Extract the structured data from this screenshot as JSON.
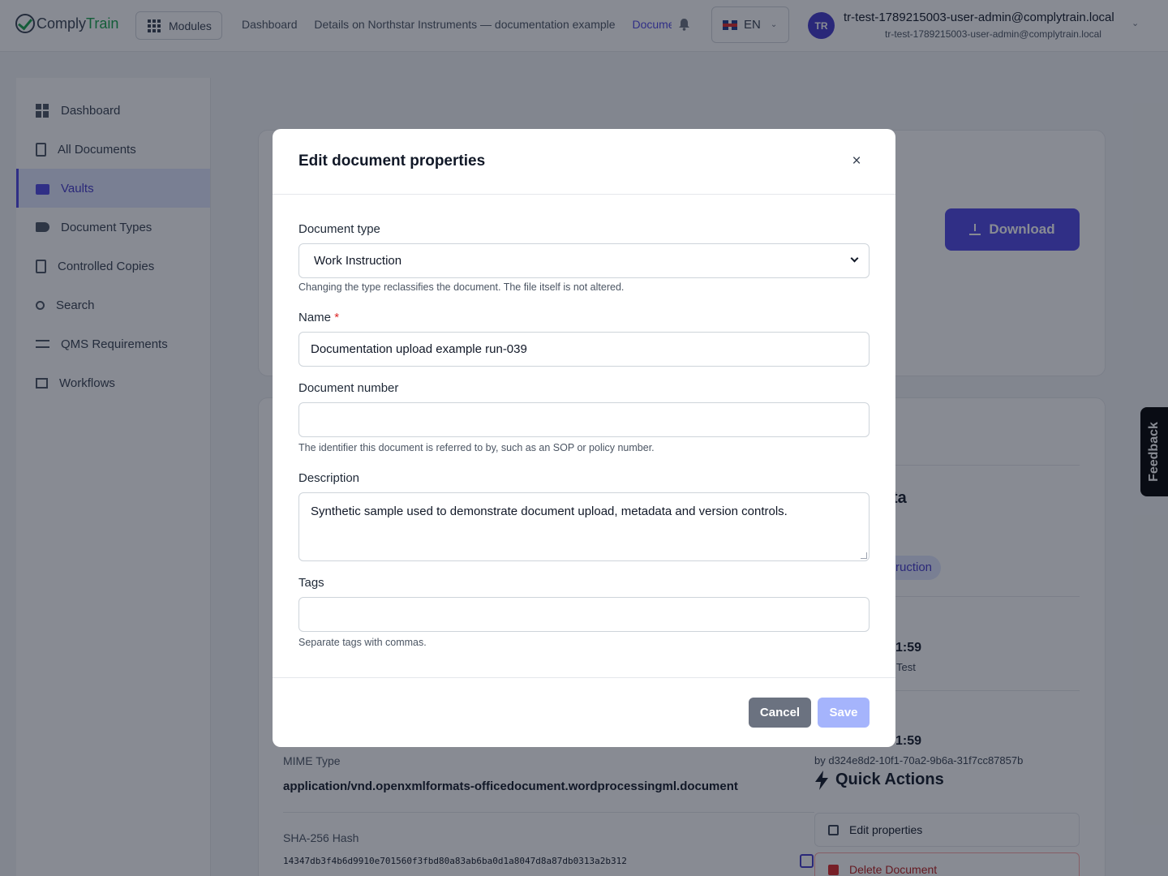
{
  "header": {
    "logo_part1": "Comply",
    "logo_part2": "Train",
    "modules_label": "Modules",
    "breadcrumbs": [
      "Dashboard",
      "Details on Northstar Instruments — documentation example",
      "Documents"
    ],
    "language": "EN",
    "avatar_initials": "TR",
    "user_name": "tr-test-1789215003-user-admin@complytrain.local",
    "user_email": "tr-test-1789215003-user-admin@complytrain.local"
  },
  "sidebar": {
    "items": [
      {
        "label": "Dashboard",
        "icon": "dashboard-icon"
      },
      {
        "label": "All Documents",
        "icon": "document-icon"
      },
      {
        "label": "Vaults",
        "icon": "folder-icon",
        "active": true
      },
      {
        "label": "Document Types",
        "icon": "tag-icon"
      },
      {
        "label": "Controlled Copies",
        "icon": "copy-icon"
      },
      {
        "label": "Search",
        "icon": "search-icon"
      },
      {
        "label": "QMS Requirements",
        "icon": "checklist-icon"
      },
      {
        "label": "Workflows",
        "icon": "workflow-icon"
      }
    ]
  },
  "background": {
    "download_label": "Download",
    "metadata_fragment": "ta",
    "type_pill_fragment": "ruction",
    "time_fragment_1": "1:59",
    "user_fragment": "Test",
    "time_fragment_2": "1:59",
    "uploaded_by": "by d324e8d2-10f1-70a2-9b6a-31f7cc87857b",
    "mime_label": "MIME Type",
    "mime_value": "application/vnd.openxmlformats-officedocument.wordprocessingml.document",
    "hash_label": "SHA-256 Hash",
    "hash_value": "14347db3f4b6d9910e701560f3fbd80a83ab6ba0d1a8047d8a87db0313a2b312",
    "quick_actions_title": "Quick Actions",
    "edit_properties_label": "Edit properties",
    "delete_document_label": "Delete Document"
  },
  "feedback_label": "Feedback",
  "modal": {
    "title": "Edit document properties",
    "doc_type_label": "Document type",
    "doc_type_value": "Work Instruction",
    "doc_type_help": "Changing the type reclassifies the document. The file itself is not altered.",
    "name_label": "Name",
    "name_required": "*",
    "name_value": "Documentation upload example run-039",
    "doc_number_label": "Document number",
    "doc_number_value": "",
    "doc_number_help": "The identifier this document is referred to by, such as an SOP or policy number.",
    "description_label": "Description",
    "description_value": "Synthetic sample used to demonstrate document upload, metadata and version controls.",
    "tags_label": "Tags",
    "tags_value": "",
    "tags_help": "Separate tags with commas.",
    "cancel_label": "Cancel",
    "save_label": "Save"
  },
  "colors": {
    "accent": "#4f46e5",
    "brand_green": "#16a34a",
    "danger": "#dc2626",
    "save_disabled": "#a5b4fc",
    "cancel": "#6b7280"
  }
}
